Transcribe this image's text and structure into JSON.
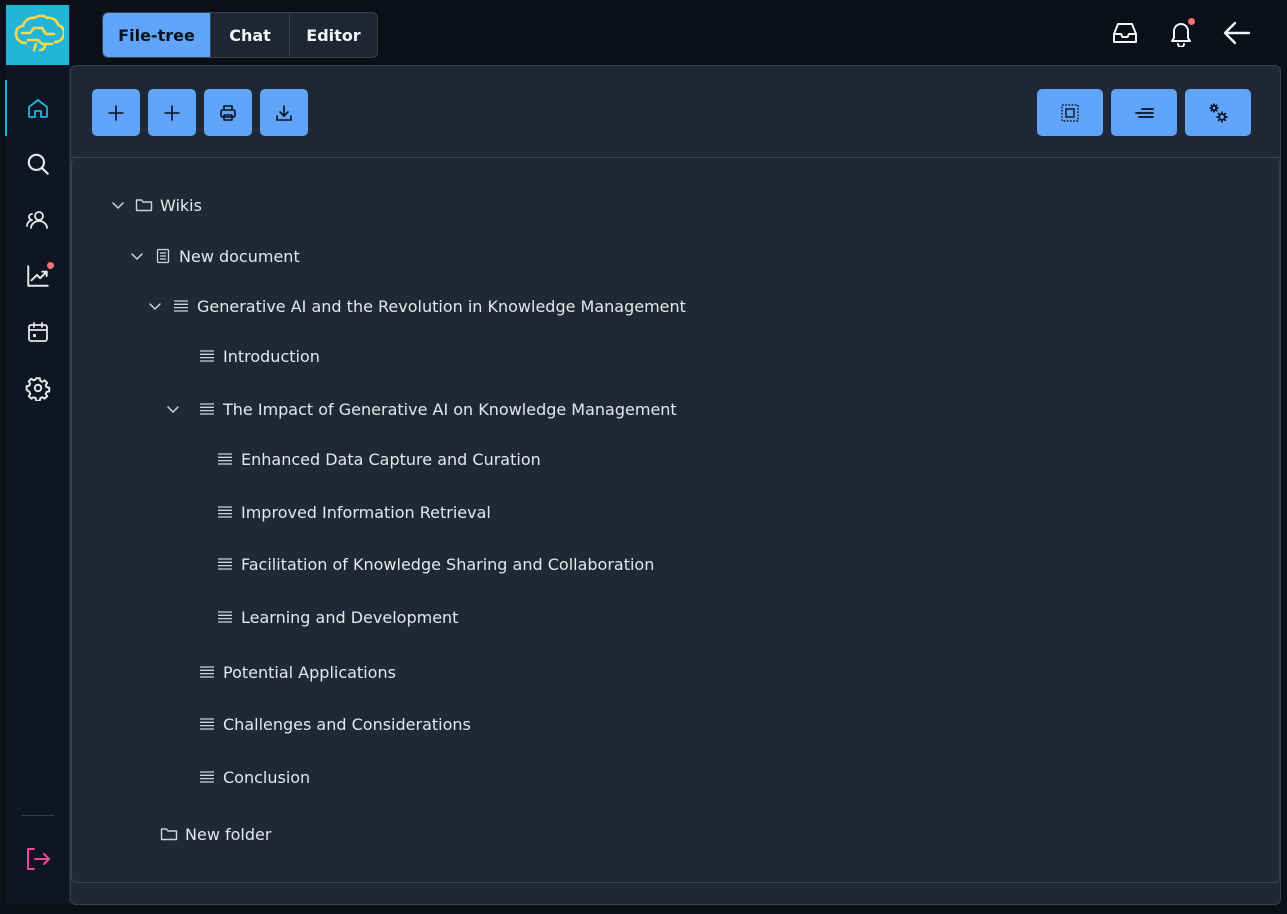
{
  "tabs": [
    {
      "label": "File-tree",
      "active": true
    },
    {
      "label": "Chat",
      "active": false
    },
    {
      "label": "Editor",
      "active": false
    }
  ],
  "colors": {
    "accent": "#60a5fa",
    "brand": "#22b5d8",
    "notification": "#f87171",
    "logout": "#ec4899"
  },
  "sidebar": {
    "items": [
      {
        "icon": "home-icon",
        "active": true,
        "badge": false
      },
      {
        "icon": "search-icon",
        "active": false,
        "badge": false
      },
      {
        "icon": "users-icon",
        "active": false,
        "badge": false
      },
      {
        "icon": "analytics-icon",
        "active": false,
        "badge": true
      },
      {
        "icon": "calendar-icon",
        "active": false,
        "badge": false
      },
      {
        "icon": "settings-icon",
        "active": false,
        "badge": false
      }
    ],
    "logout_icon": "logout-icon"
  },
  "topbar": {
    "icons": [
      "inbox-icon",
      "bell-icon",
      "back-arrow-icon"
    ],
    "bell_badge": true
  },
  "toolbar": {
    "left_buttons": [
      "add-icon",
      "add-icon",
      "print-icon",
      "download-icon"
    ],
    "right_buttons": [
      "select-all-icon",
      "text-align-icon",
      "cogs-icon"
    ]
  },
  "tree": [
    {
      "label": "Wikis",
      "type": "folder",
      "expanded": true,
      "depth": 0
    },
    {
      "label": "New document",
      "type": "document",
      "expanded": true,
      "depth": 1
    },
    {
      "label": "Generative AI and the Revolution in Knowledge Management",
      "type": "section",
      "expanded": true,
      "depth": 2
    },
    {
      "label": "Introduction",
      "type": "section",
      "expanded": null,
      "depth": 3
    },
    {
      "label": "The Impact of Generative AI on Knowledge Management",
      "type": "section",
      "expanded": true,
      "depth": 3
    },
    {
      "label": "Enhanced Data Capture and Curation",
      "type": "section",
      "expanded": null,
      "depth": 4
    },
    {
      "label": "Improved Information Retrieval",
      "type": "section",
      "expanded": null,
      "depth": 4
    },
    {
      "label": "Facilitation of Knowledge Sharing and Collaboration",
      "type": "section",
      "expanded": null,
      "depth": 4
    },
    {
      "label": "Learning and Development",
      "type": "section",
      "expanded": null,
      "depth": 4
    },
    {
      "label": "Potential Applications",
      "type": "section",
      "expanded": null,
      "depth": 3
    },
    {
      "label": "Challenges and Considerations",
      "type": "section",
      "expanded": null,
      "depth": 3
    },
    {
      "label": "Conclusion",
      "type": "section",
      "expanded": null,
      "depth": 3
    },
    {
      "label": "New folder",
      "type": "folder",
      "expanded": null,
      "depth": 1
    }
  ]
}
